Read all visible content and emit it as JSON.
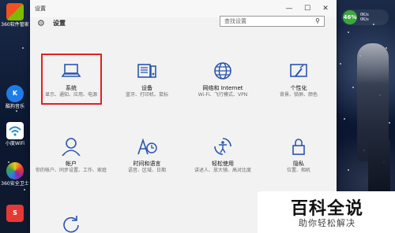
{
  "window": {
    "title": "设置"
  },
  "header": {
    "heading": "设置",
    "search_placeholder": "查找设置"
  },
  "window_controls": {
    "minimize": "—",
    "maximize": "☐",
    "close": "✕"
  },
  "tiles": [
    {
      "name": "系统",
      "desc": "显示、通知、应用、电源",
      "icon": "laptop-icon"
    },
    {
      "name": "设备",
      "desc": "蓝牙、打印机、鼠标",
      "icon": "keyboard-device-icon"
    },
    {
      "name": "网络和 Internet",
      "desc": "Wi-Fi、飞行模式、VPN",
      "icon": "globe-icon"
    },
    {
      "name": "个性化",
      "desc": "背景、锁屏、颜色",
      "icon": "paint-icon"
    },
    {
      "name": "帐户",
      "desc": "你的帐户、同步设置、工作、家庭",
      "icon": "person-icon"
    },
    {
      "name": "时间和语言",
      "desc": "语音、区域、日期",
      "icon": "time-language-icon"
    },
    {
      "name": "轻松使用",
      "desc": "讲述人、放大镜、高对比度",
      "icon": "ease-of-access-icon"
    },
    {
      "name": "隐私",
      "desc": "位置、相机",
      "icon": "lock-icon"
    },
    {
      "name": "",
      "desc": "",
      "icon": "update-icon"
    }
  ],
  "desktop": {
    "icons": [
      {
        "label": "360软件管家"
      },
      {
        "label": "酷狗音乐"
      },
      {
        "label": "小度WiFi"
      },
      {
        "label": "360安全卫士"
      },
      {
        "label": ""
      }
    ],
    "widget": {
      "percent": "46%",
      "up": "0K/s",
      "down": "0K/s"
    }
  },
  "watermark": {
    "title": "百科全说",
    "subtitle": "助你轻松解决"
  },
  "colors": {
    "accent": "#2b56b0",
    "highlight": "#e0221f",
    "window_bg": "#f2f2f2"
  }
}
